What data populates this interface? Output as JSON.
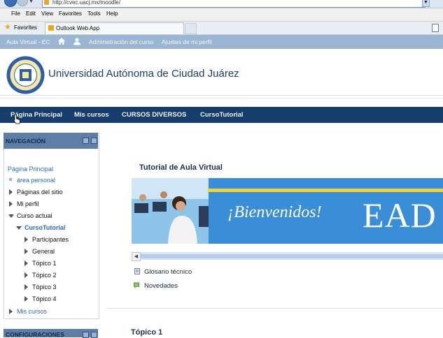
{
  "browser": {
    "url": "http://cvec.uacj.mx/moodle/",
    "menu": [
      "File",
      "Edit",
      "View",
      "Favorites",
      "Tools",
      "Help"
    ],
    "favorites_label": "Favorites",
    "tab_title": "Outlook Web App"
  },
  "topbar": {
    "site_label": "Aula Virtual - EC",
    "links": [
      "Administración del curso",
      "Ajustes de mi perfil"
    ]
  },
  "header": {
    "title": "Universidad Autónoma de Ciudad Juárez"
  },
  "custom_menu": {
    "items": [
      "Página Principal",
      "Mis cursos",
      "CURSOS DIVERSOS",
      "CursoTutorial"
    ]
  },
  "navigation": {
    "title": "NAVEGACIÓN",
    "home": "Página Principal",
    "personal_area": "área personal",
    "site_pages": "Páginas del sitio",
    "my_profile": "Mi perfil",
    "current_course": "Curso actual",
    "course_name": "CursoTutorial",
    "participants": "Participantes",
    "general": "General",
    "topics": [
      "Tópico 1",
      "Tópico 2",
      "Tópico 3",
      "Tópico 4"
    ],
    "my_courses": "Mis cursos"
  },
  "config_block": {
    "title": "CONFIGURACIONES"
  },
  "main": {
    "title": "Tutorial de Aula Virtual",
    "banner_welcome": "¡Bienvenidos!",
    "banner_brand": "EAD",
    "resources": [
      {
        "label": "Glosario técnico",
        "icon": "glossary-icon"
      },
      {
        "label": "Novedades",
        "icon": "forum-icon"
      }
    ],
    "topic_title": "Tópico 1"
  },
  "colors": {
    "topbar": "#9bb6d3",
    "custom_menu": "#173d6c",
    "block_header": "#5e7ea7",
    "link": "#2e6ab8",
    "banner": "#3a8ed8"
  }
}
